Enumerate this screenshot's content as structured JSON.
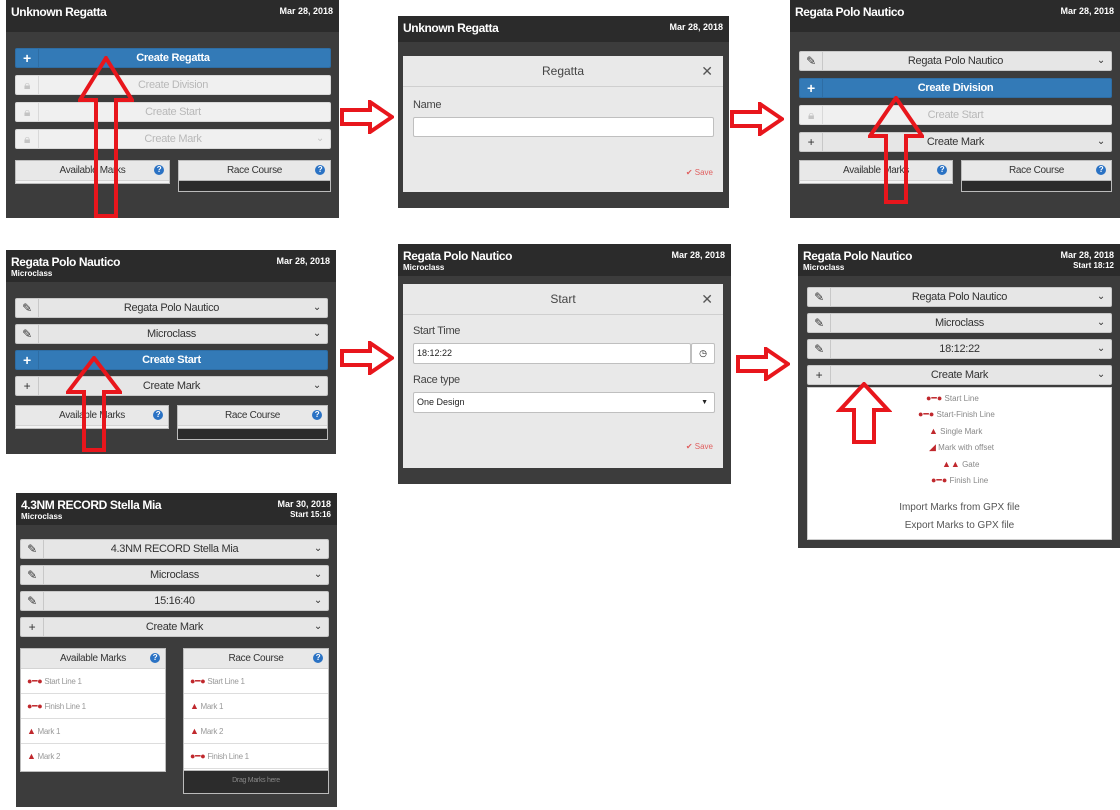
{
  "p1": {
    "title": "Unknown Regatta",
    "date": "Mar 28, 2018",
    "create_regatta": "Create Regatta",
    "create_division": "Create Division",
    "create_start": "Create Start",
    "create_mark": "Create Mark",
    "available_marks": "Available Marks",
    "race_course": "Race Course"
  },
  "p2": {
    "title": "Unknown Regatta",
    "date": "Mar 28, 2018",
    "modal_title": "Regatta",
    "name_label": "Name",
    "name_value": "",
    "save": "Save"
  },
  "p3": {
    "title": "Regata Polo Nautico",
    "date": "Mar 28, 2018",
    "regatta": "Regata Polo Nautico",
    "create_division": "Create Division",
    "create_start": "Create Start",
    "create_mark": "Create Mark",
    "available_marks": "Available Marks",
    "race_course": "Race Course"
  },
  "p4": {
    "title": "Regata Polo Nautico",
    "subtitle": "Microclass",
    "date": "Mar 28, 2018",
    "regatta": "Regata Polo Nautico",
    "division": "Microclass",
    "create_start": "Create Start",
    "create_mark": "Create Mark",
    "available_marks": "Available Marks",
    "race_course": "Race Course"
  },
  "p5": {
    "title": "Regata Polo Nautico",
    "subtitle": "Microclass",
    "date": "Mar 28, 2018",
    "modal_title": "Start",
    "start_time_label": "Start Time",
    "start_time_value": "18:12:22",
    "race_type_label": "Race type",
    "race_type_value": "One Design",
    "save": "Save"
  },
  "p6": {
    "title": "Regata Polo Nautico",
    "subtitle": "Microclass",
    "date": "Mar 28, 2018",
    "start": "Start 18:12",
    "regatta": "Regata Polo Nautico",
    "division": "Microclass",
    "time": "18:12:22",
    "create_mark": "Create Mark",
    "marks": [
      "Start Line",
      "Start-Finish Line",
      "Single Mark",
      "Mark with offset",
      "Gate",
      "Finish Line"
    ],
    "import_gpx": "Import Marks from GPX file",
    "export_gpx": "Export Marks to GPX file"
  },
  "p7": {
    "title": "4.3NM RECORD Stella Mia",
    "subtitle": "Microclass",
    "date": "Mar 30, 2018",
    "start": "Start 15:16",
    "regatta": "4.3NM RECORD Stella Mia",
    "division": "Microclass",
    "time": "15:16:40",
    "create_mark": "Create Mark",
    "available_marks": "Available Marks",
    "race_course": "Race Course",
    "available_list": [
      "Start Line 1",
      "Finish Line 1",
      "Mark 1",
      "Mark 2"
    ],
    "course_list": [
      "Start Line 1",
      "Mark 1",
      "Mark 2",
      "Finish Line 1"
    ],
    "drag_hint": "Drag Marks here"
  },
  "colors": {
    "accent": "#337ab7",
    "arrow": "#e8161c",
    "panel": "#3c3c3c",
    "header": "#2b2b2b"
  }
}
